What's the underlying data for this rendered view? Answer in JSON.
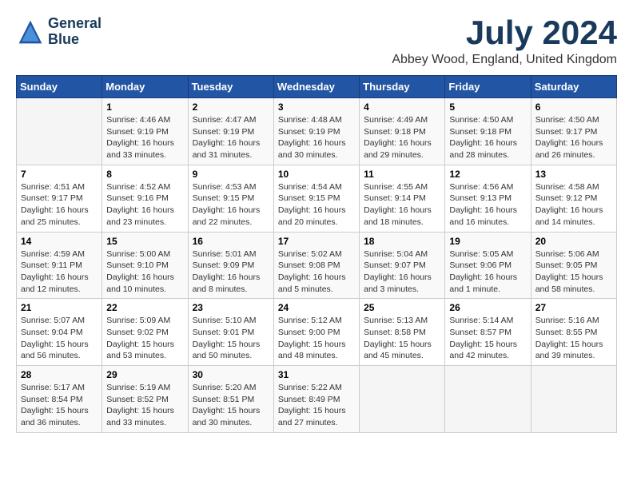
{
  "header": {
    "logo_line1": "General",
    "logo_line2": "Blue",
    "title": "July 2024",
    "subtitle": "Abbey Wood, England, United Kingdom"
  },
  "calendar": {
    "days_of_week": [
      "Sunday",
      "Monday",
      "Tuesday",
      "Wednesday",
      "Thursday",
      "Friday",
      "Saturday"
    ],
    "weeks": [
      [
        {
          "day": "",
          "info": ""
        },
        {
          "day": "1",
          "info": "Sunrise: 4:46 AM\nSunset: 9:19 PM\nDaylight: 16 hours\nand 33 minutes."
        },
        {
          "day": "2",
          "info": "Sunrise: 4:47 AM\nSunset: 9:19 PM\nDaylight: 16 hours\nand 31 minutes."
        },
        {
          "day": "3",
          "info": "Sunrise: 4:48 AM\nSunset: 9:19 PM\nDaylight: 16 hours\nand 30 minutes."
        },
        {
          "day": "4",
          "info": "Sunrise: 4:49 AM\nSunset: 9:18 PM\nDaylight: 16 hours\nand 29 minutes."
        },
        {
          "day": "5",
          "info": "Sunrise: 4:50 AM\nSunset: 9:18 PM\nDaylight: 16 hours\nand 28 minutes."
        },
        {
          "day": "6",
          "info": "Sunrise: 4:50 AM\nSunset: 9:17 PM\nDaylight: 16 hours\nand 26 minutes."
        }
      ],
      [
        {
          "day": "7",
          "info": "Sunrise: 4:51 AM\nSunset: 9:17 PM\nDaylight: 16 hours\nand 25 minutes."
        },
        {
          "day": "8",
          "info": "Sunrise: 4:52 AM\nSunset: 9:16 PM\nDaylight: 16 hours\nand 23 minutes."
        },
        {
          "day": "9",
          "info": "Sunrise: 4:53 AM\nSunset: 9:15 PM\nDaylight: 16 hours\nand 22 minutes."
        },
        {
          "day": "10",
          "info": "Sunrise: 4:54 AM\nSunset: 9:15 PM\nDaylight: 16 hours\nand 20 minutes."
        },
        {
          "day": "11",
          "info": "Sunrise: 4:55 AM\nSunset: 9:14 PM\nDaylight: 16 hours\nand 18 minutes."
        },
        {
          "day": "12",
          "info": "Sunrise: 4:56 AM\nSunset: 9:13 PM\nDaylight: 16 hours\nand 16 minutes."
        },
        {
          "day": "13",
          "info": "Sunrise: 4:58 AM\nSunset: 9:12 PM\nDaylight: 16 hours\nand 14 minutes."
        }
      ],
      [
        {
          "day": "14",
          "info": "Sunrise: 4:59 AM\nSunset: 9:11 PM\nDaylight: 16 hours\nand 12 minutes."
        },
        {
          "day": "15",
          "info": "Sunrise: 5:00 AM\nSunset: 9:10 PM\nDaylight: 16 hours\nand 10 minutes."
        },
        {
          "day": "16",
          "info": "Sunrise: 5:01 AM\nSunset: 9:09 PM\nDaylight: 16 hours\nand 8 minutes."
        },
        {
          "day": "17",
          "info": "Sunrise: 5:02 AM\nSunset: 9:08 PM\nDaylight: 16 hours\nand 5 minutes."
        },
        {
          "day": "18",
          "info": "Sunrise: 5:04 AM\nSunset: 9:07 PM\nDaylight: 16 hours\nand 3 minutes."
        },
        {
          "day": "19",
          "info": "Sunrise: 5:05 AM\nSunset: 9:06 PM\nDaylight: 16 hours\nand 1 minute."
        },
        {
          "day": "20",
          "info": "Sunrise: 5:06 AM\nSunset: 9:05 PM\nDaylight: 15 hours\nand 58 minutes."
        }
      ],
      [
        {
          "day": "21",
          "info": "Sunrise: 5:07 AM\nSunset: 9:04 PM\nDaylight: 15 hours\nand 56 minutes."
        },
        {
          "day": "22",
          "info": "Sunrise: 5:09 AM\nSunset: 9:02 PM\nDaylight: 15 hours\nand 53 minutes."
        },
        {
          "day": "23",
          "info": "Sunrise: 5:10 AM\nSunset: 9:01 PM\nDaylight: 15 hours\nand 50 minutes."
        },
        {
          "day": "24",
          "info": "Sunrise: 5:12 AM\nSunset: 9:00 PM\nDaylight: 15 hours\nand 48 minutes."
        },
        {
          "day": "25",
          "info": "Sunrise: 5:13 AM\nSunset: 8:58 PM\nDaylight: 15 hours\nand 45 minutes."
        },
        {
          "day": "26",
          "info": "Sunrise: 5:14 AM\nSunset: 8:57 PM\nDaylight: 15 hours\nand 42 minutes."
        },
        {
          "day": "27",
          "info": "Sunrise: 5:16 AM\nSunset: 8:55 PM\nDaylight: 15 hours\nand 39 minutes."
        }
      ],
      [
        {
          "day": "28",
          "info": "Sunrise: 5:17 AM\nSunset: 8:54 PM\nDaylight: 15 hours\nand 36 minutes."
        },
        {
          "day": "29",
          "info": "Sunrise: 5:19 AM\nSunset: 8:52 PM\nDaylight: 15 hours\nand 33 minutes."
        },
        {
          "day": "30",
          "info": "Sunrise: 5:20 AM\nSunset: 8:51 PM\nDaylight: 15 hours\nand 30 minutes."
        },
        {
          "day": "31",
          "info": "Sunrise: 5:22 AM\nSunset: 8:49 PM\nDaylight: 15 hours\nand 27 minutes."
        },
        {
          "day": "",
          "info": ""
        },
        {
          "day": "",
          "info": ""
        },
        {
          "day": "",
          "info": ""
        }
      ]
    ]
  }
}
